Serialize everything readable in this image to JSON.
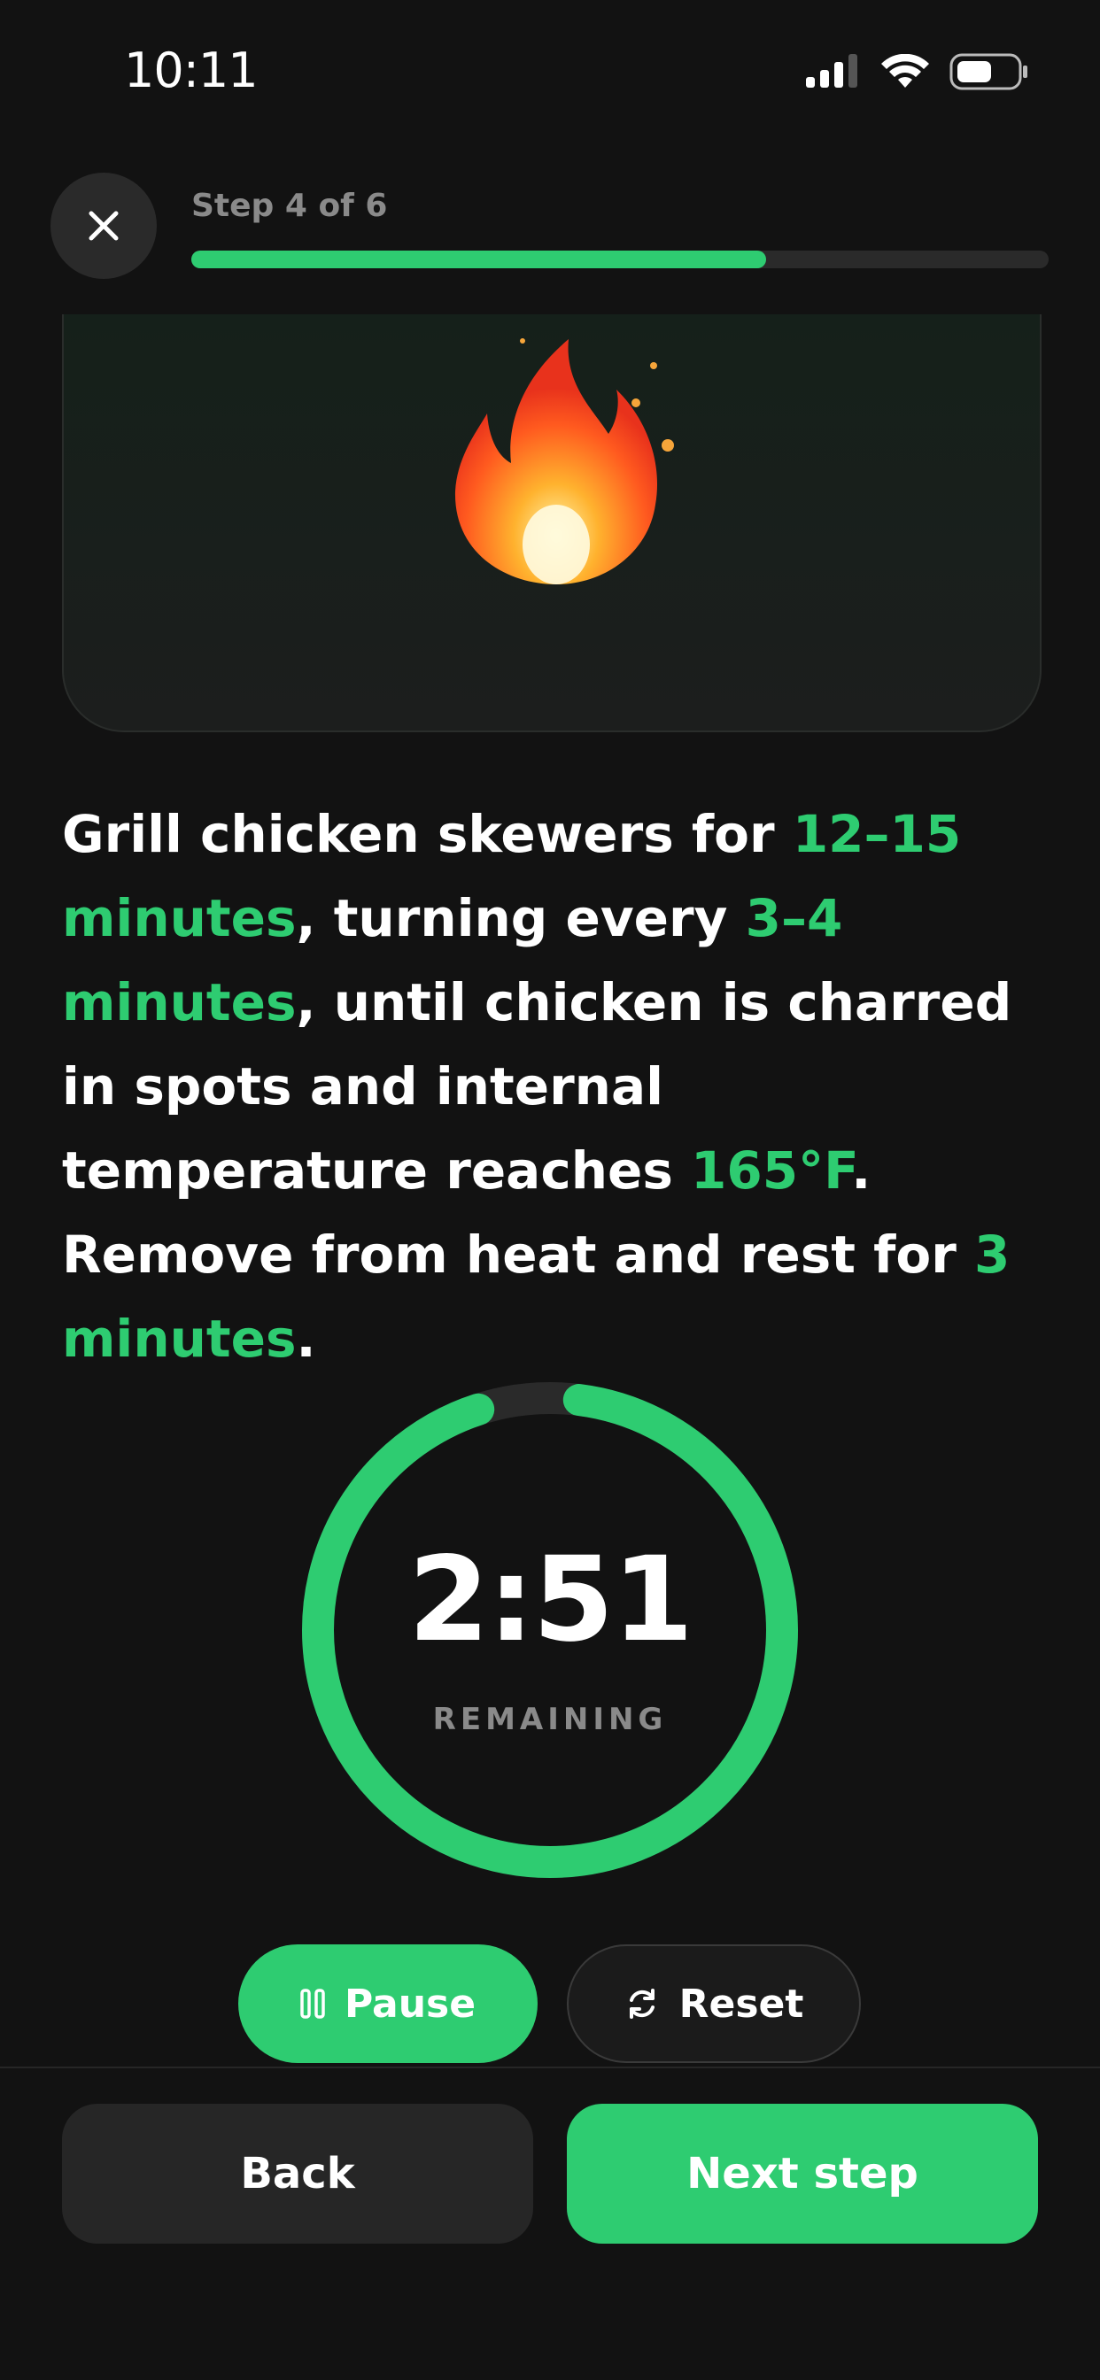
{
  "status_bar": {
    "time": "10:11",
    "icons": [
      "cellular-signal-icon",
      "wifi-icon",
      "battery-icon"
    ]
  },
  "header": {
    "close_icon": "close-icon",
    "step_label": "Step 4 of 6",
    "progress": 0.67
  },
  "media": {
    "emoji": "🔥"
  },
  "instruction": {
    "segments": [
      {
        "text": "Grill chicken skewers for ",
        "highlight": false
      },
      {
        "text": "12–15 minutes",
        "highlight": true
      },
      {
        "text": ", turning every ",
        "highlight": false
      },
      {
        "text": "3–4 minutes",
        "highlight": true
      },
      {
        "text": ", until chicken is charred in spots and internal temperature reaches ",
        "highlight": false
      },
      {
        "text": "165°F",
        "highlight": true
      },
      {
        "text": ". Remove from heat and rest for ",
        "highlight": false
      },
      {
        "text": "3 minutes",
        "highlight": true
      },
      {
        "text": ".",
        "highlight": false
      }
    ]
  },
  "timer": {
    "time": "2:51",
    "label": "REMAINING",
    "progress": 0.95
  },
  "controls": {
    "pause_label": "Pause",
    "pause_icon": "pause-icon",
    "reset_label": "Reset",
    "reset_icon": "reset-icon"
  },
  "footer": {
    "back_label": "Back",
    "next_label": "Next step"
  },
  "colors": {
    "accent": "#2ecc71",
    "background": "#121212",
    "surface": "#262626",
    "muted": "#8a8a8a"
  }
}
